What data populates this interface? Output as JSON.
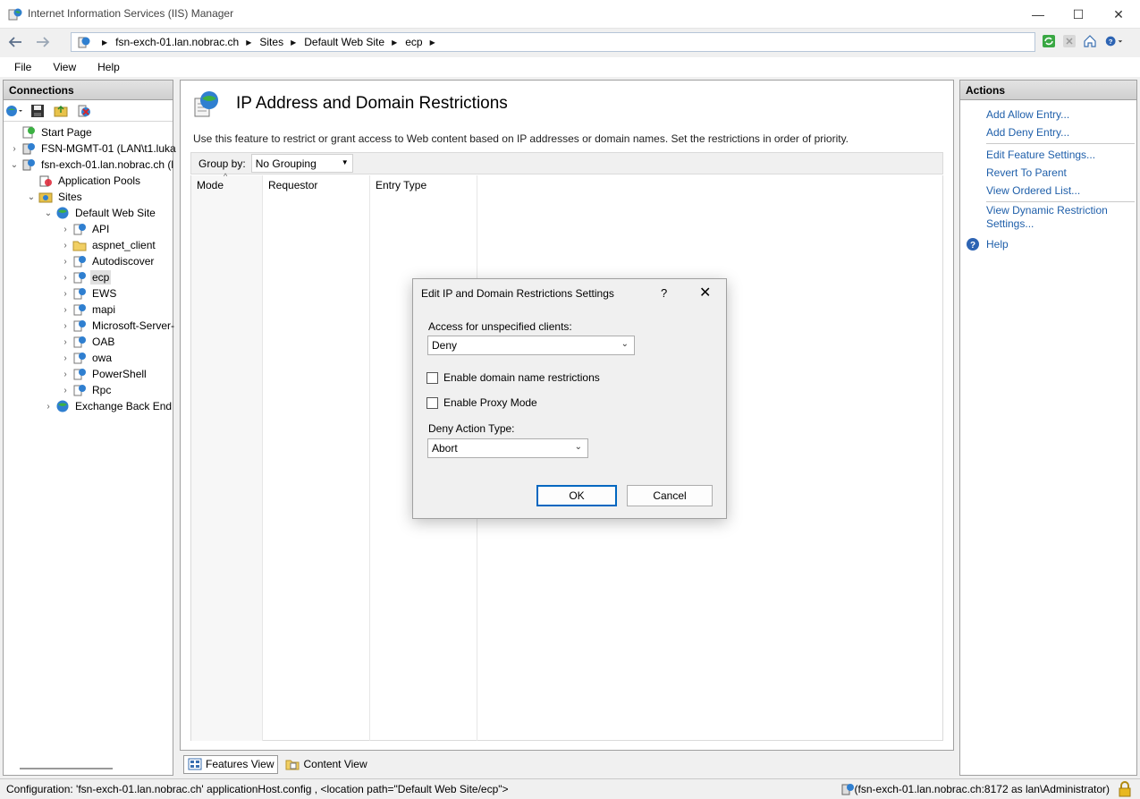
{
  "window": {
    "title": "Internet Information Services (IIS) Manager",
    "minimize": "—",
    "maximize": "☐",
    "close": "✕"
  },
  "address": {
    "crumbs": [
      "fsn-exch-01.lan.nobrac.ch",
      "Sites",
      "Default Web Site",
      "ecp"
    ]
  },
  "menu": {
    "items": [
      "File",
      "View",
      "Help"
    ]
  },
  "connections": {
    "title": "Connections",
    "tree": [
      {
        "label": "Start Page",
        "expander": "",
        "icon": "start-page-icon"
      },
      {
        "label": "FSN-MGMT-01 (LAN\\t1.luka",
        "expander": "›",
        "icon": "server-icon"
      },
      {
        "label": "fsn-exch-01.lan.nobrac.ch (l",
        "expander": "⌄",
        "icon": "server-icon"
      },
      {
        "label": "Application Pools",
        "expander": "",
        "icon": "app-pools-icon"
      },
      {
        "label": "Sites",
        "expander": "⌄",
        "icon": "sites-folder-icon"
      },
      {
        "label": "Default Web Site",
        "expander": "⌄",
        "icon": "globe-icon"
      },
      {
        "label": "API",
        "expander": "›",
        "icon": "app-icon"
      },
      {
        "label": "aspnet_client",
        "expander": "›",
        "icon": "folder-icon"
      },
      {
        "label": "Autodiscover",
        "expander": "›",
        "icon": "app-icon"
      },
      {
        "label": "ecp",
        "expander": "›",
        "icon": "app-icon"
      },
      {
        "label": "EWS",
        "expander": "›",
        "icon": "app-icon"
      },
      {
        "label": "mapi",
        "expander": "›",
        "icon": "app-icon"
      },
      {
        "label": "Microsoft-Server-",
        "expander": "›",
        "icon": "app-icon"
      },
      {
        "label": "OAB",
        "expander": "›",
        "icon": "app-icon"
      },
      {
        "label": "owa",
        "expander": "›",
        "icon": "app-icon"
      },
      {
        "label": "PowerShell",
        "expander": "›",
        "icon": "app-icon"
      },
      {
        "label": "Rpc",
        "expander": "›",
        "icon": "app-icon"
      },
      {
        "label": "Exchange Back End",
        "expander": "›",
        "icon": "globe-icon"
      }
    ]
  },
  "feature": {
    "title": "IP Address and Domain Restrictions",
    "description": "Use this feature to restrict or grant access to Web content based on IP addresses or domain names. Set the restrictions in order of priority.",
    "group_by_label": "Group by:",
    "group_by_value": "No Grouping",
    "columns": [
      "Mode",
      "Requestor",
      "Entry Type"
    ]
  },
  "views": {
    "features": "Features View",
    "content": "Content View"
  },
  "actions": {
    "title": "Actions",
    "items": [
      "Add Allow Entry...",
      "Add Deny Entry...",
      "Edit Feature Settings...",
      "Revert To Parent",
      "View Ordered List...",
      "View Dynamic Restriction",
      "Settings...",
      "Help"
    ]
  },
  "dialog": {
    "title": "Edit IP and Domain Restrictions Settings",
    "help": "?",
    "close": "✕",
    "access_label": "Access for unspecified clients:",
    "access_value": "Deny",
    "domain_restrictions": "Enable domain name restrictions",
    "proxy_mode": "Enable Proxy Mode",
    "deny_action_label": "Deny Action Type:",
    "deny_action_value": "Abort",
    "ok": "OK",
    "cancel": "Cancel"
  },
  "status": {
    "left": "Configuration: 'fsn-exch-01.lan.nobrac.ch' applicationHost.config , <location path=\"Default Web Site/ecp\">",
    "right": "(fsn-exch-01.lan.nobrac.ch:8172 as lan\\Administrator)"
  }
}
